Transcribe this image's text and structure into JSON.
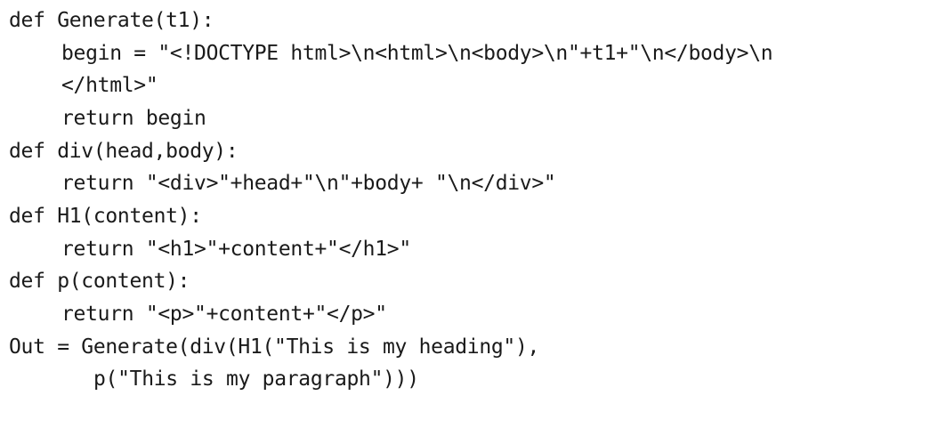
{
  "code": {
    "lines": [
      "def Generate(t1):",
      "begin = \"<!DOCTYPE html>\\n<html>\\n<body>\\n\"+t1+\"\\n</body>\\n",
      "</html>\"",
      "return begin",
      "def div(head,body):",
      "return \"<div>\"+head+\"\\n\"+body+ \"\\n</div>\"",
      "def H1(content):",
      "return \"<h1>\"+content+\"</h1>\"",
      "def p(content):",
      "return \"<p>\"+content+\"</p>\"",
      "Out = Generate(div(H1(\"This is my heading\"),",
      "p(\"This is my paragraph\")))"
    ]
  }
}
